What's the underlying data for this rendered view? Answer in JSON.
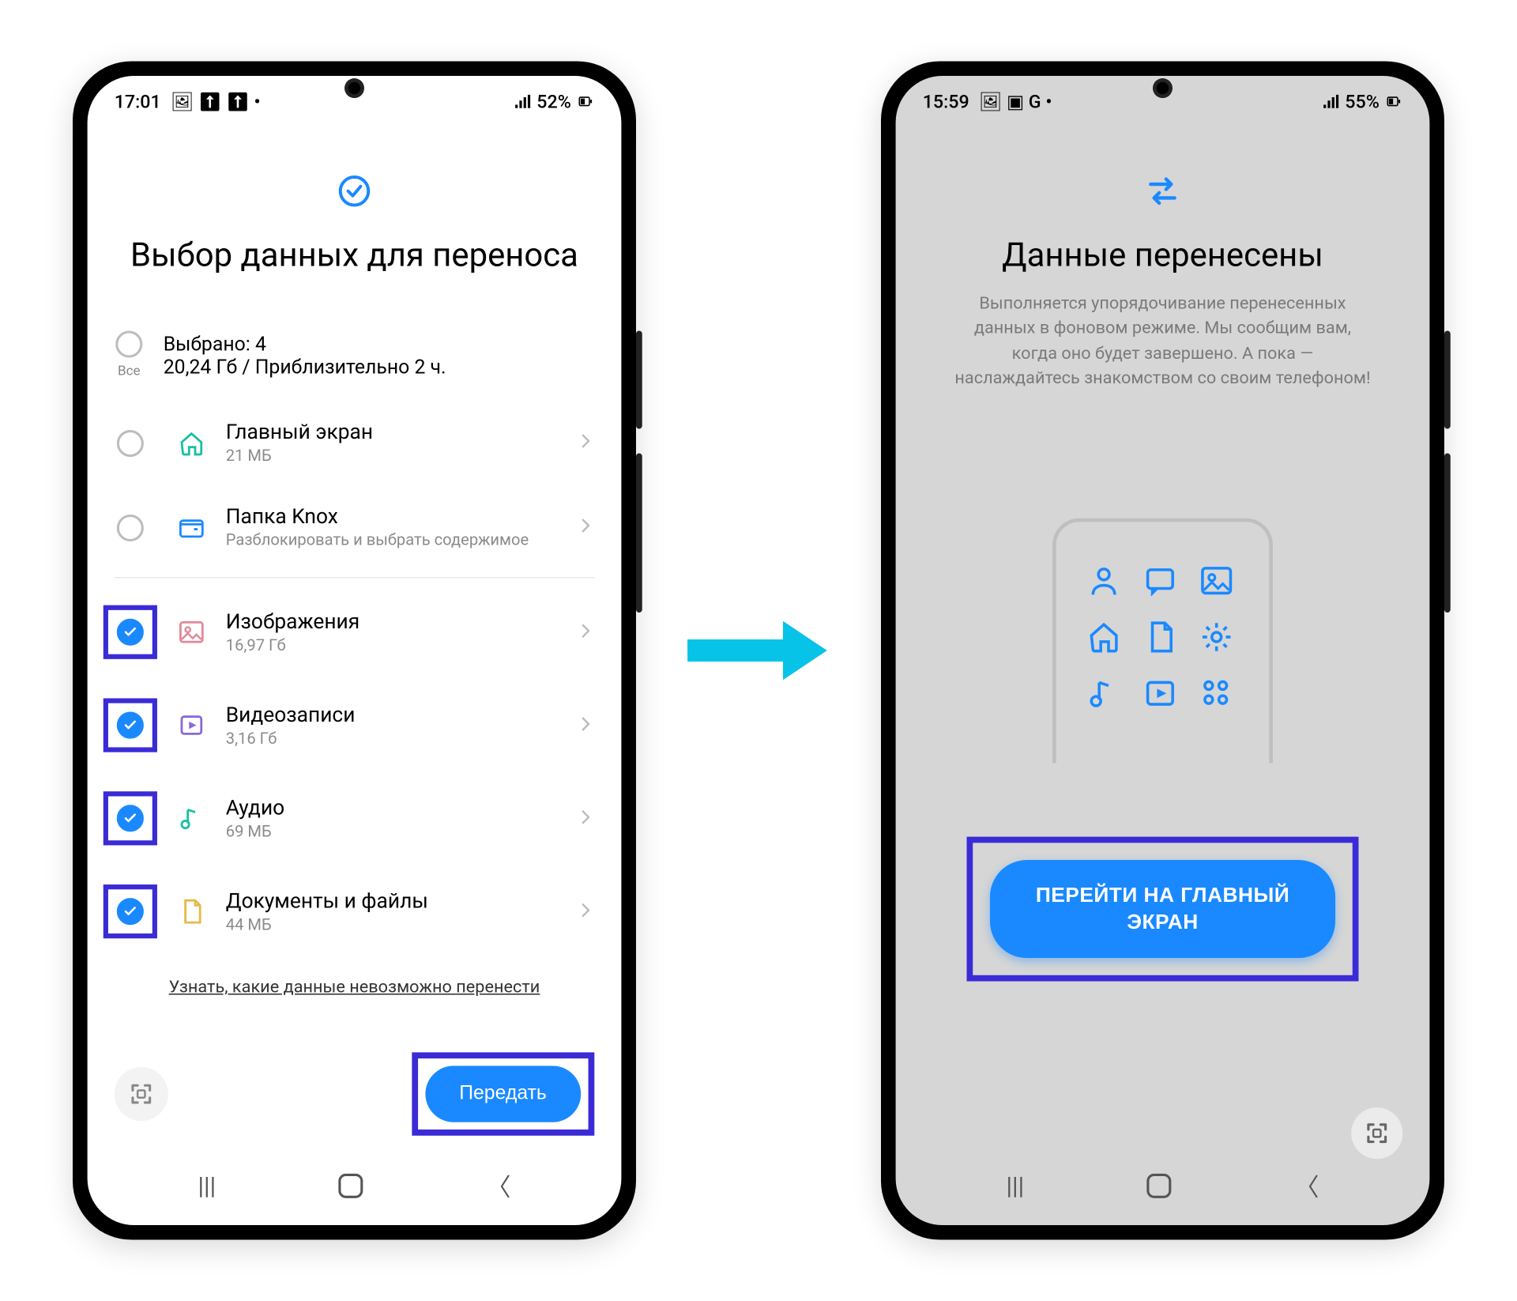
{
  "phone1": {
    "status": {
      "time": "17:01",
      "battery": "52%"
    },
    "header": {
      "title": "Выбор данных для переноса"
    },
    "summary": {
      "all_label": "Все",
      "selected": "Выбрано: 4",
      "detail": "20,24 Гб / Приблизительно 2 ч."
    },
    "items": [
      {
        "title": "Главный экран",
        "sub": "21 МБ",
        "checked": false,
        "icon": "home",
        "color": "#18bfa3"
      },
      {
        "title": "Папка Knox",
        "sub": "Разблокировать и выбрать содержимое",
        "checked": false,
        "icon": "folder",
        "color": "#1a89ff"
      },
      {
        "title": "Изображения",
        "sub": "16,97 Гб",
        "checked": true,
        "icon": "image",
        "color": "#e3889a"
      },
      {
        "title": "Видеозаписи",
        "sub": "3,16 Гб",
        "checked": true,
        "icon": "video",
        "color": "#8b67d6"
      },
      {
        "title": "Аудио",
        "sub": "69 МБ",
        "checked": true,
        "icon": "music",
        "color": "#18bfa3"
      },
      {
        "title": "Документы и файлы",
        "sub": "44 МБ",
        "checked": true,
        "icon": "doc",
        "color": "#e6b94a"
      }
    ],
    "link": "Узнать, какие данные невозможно перенести",
    "transfer_btn": "Передать"
  },
  "phone2": {
    "status": {
      "time": "15:59",
      "battery": "55%"
    },
    "header": {
      "title": "Данные перенесены",
      "desc": "Выполняется упорядочивание перенесенных данных в фоновом режиме. Мы сообщим вам, когда оно будет завершено. А пока — наслаждайтесь знакомством со своим телефоном!"
    },
    "primary_btn": "ПЕРЕЙТИ НА ГЛАВНЫЙ ЭКРАН"
  },
  "colors": {
    "accent": "#1a89ff",
    "highlight": "#3a2bd6",
    "arrow": "#00c3e6"
  }
}
